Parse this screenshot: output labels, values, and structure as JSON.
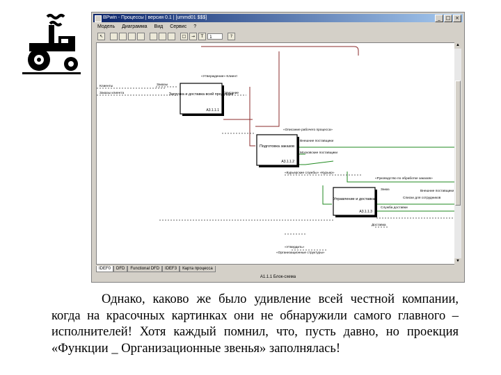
{
  "window": {
    "title": "BPwin - Процессы | версия 0.1 | [ummd01 $$$]",
    "title_buttons": [
      "_",
      "□",
      "×"
    ],
    "menu": [
      "Модель",
      "Диаграмма",
      "Вид",
      "Сервис",
      "?"
    ],
    "toolbar": {
      "icons": [
        "pointer-tool",
        "new-icon",
        "open-icon",
        "save-icon",
        "print-icon",
        "cut-icon",
        "copy-icon",
        "paste-icon",
        "box-tool",
        "arrow-tool",
        "text-tool"
      ],
      "zoom_value": "1",
      "help_icon": "help-icon"
    },
    "tabs": [
      "IDEF0",
      "DFD",
      "Functional DFD",
      "IDEF3",
      "Карта процесса"
    ],
    "active_tab": "IDEF0",
    "status": "А1.1.1 Блок-схема"
  },
  "diagram": {
    "boxes": [
      {
        "label": "Загрузка и доставка всей продукции",
        "id": "А3.1.1.1"
      },
      {
        "label": "Подготовка заказов",
        "id": "А3.1.1.2"
      },
      {
        "label": "Управление и доставка",
        "id": "А3.1.1.3"
      }
    ],
    "arrow_labels": [
      "Клиенты",
      "Заказы клиента",
      "«Утверждение» Клиент",
      "Описание",
      "Заказы",
      "«Описание рабочего процесса»",
      "Внешние поставщики",
      "Московские поставщики",
      "«Курьерские службы» «Курьер»",
      "«Руководство по обработке заказов»",
      "Заказ",
      "Внешние поставщики",
      "Списки для сотрудников",
      "Служба доставки",
      "«Утвердить»",
      "«Организационные структуры»",
      "Доставка"
    ]
  },
  "caption": "Однако, каково же было удивление всей честной компании, когда на красочных картинках они не обнаружили самого главного – исполнителей! Хотя каждый помнил, что, пусть давно, но проекция «Функции _ Организационные звенья» заполнялась!",
  "colors": {
    "arrow_red": "#8b2b2b",
    "arrow_green": "#1f8a1f",
    "title_blue": "#0a246a"
  }
}
